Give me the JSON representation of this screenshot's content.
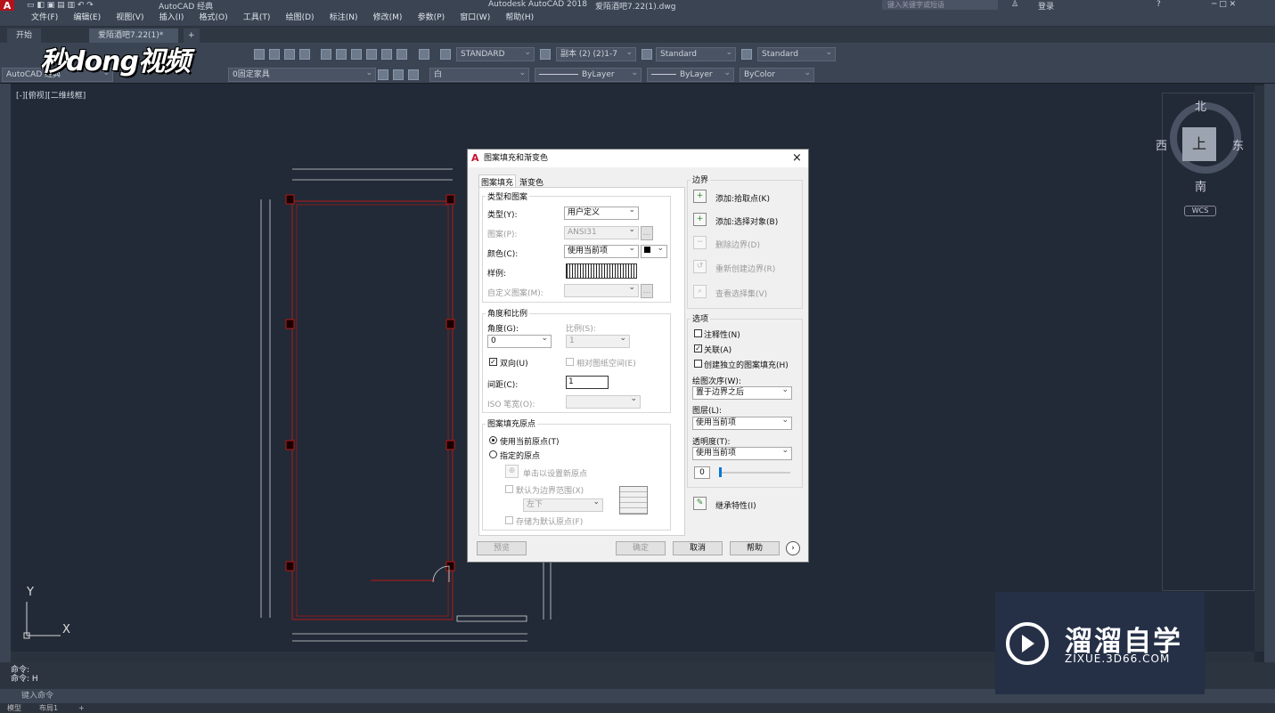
{
  "app": {
    "title": "Autodesk AutoCAD 2018",
    "file": "爱陌酒吧7.22(1).dwg",
    "search_placeholder": "键入关键字或短语",
    "login": "登录",
    "workspace": "AutoCAD 经典"
  },
  "menu": [
    "文件(F)",
    "编辑(E)",
    "视图(V)",
    "插入(I)",
    "格式(O)",
    "工具(T)",
    "绘图(D)",
    "标注(N)",
    "修改(M)",
    "参数(P)",
    "窗口(W)",
    "帮助(H)"
  ],
  "filetabs": {
    "start": "开始",
    "current": "爱陌酒吧7.22(1)*",
    "add": "+"
  },
  "toolbar": {
    "textstyle": "STANDARD",
    "dimstyle": "副本 (2) (2)1-7",
    "tablestyle": "Standard",
    "mleaderstyle": "Standard",
    "workspace_label": "AutoCAD 经典",
    "layer": "0固定家具",
    "color": "白",
    "linetype": "ByLayer",
    "lineweight": "ByLayer",
    "plotstyle": "ByColor"
  },
  "viewport": {
    "label": "[-][俯视][二维线框]"
  },
  "viewcube": {
    "north": "北",
    "south": "南",
    "east": "东",
    "west": "西",
    "top": "上",
    "wcs": "WCS"
  },
  "ucs": {
    "y": "Y",
    "x": "X"
  },
  "logo": "秒dong视频",
  "watermark": {
    "brand": "溜溜自学",
    "url": "ZIXUE.3D66.COM"
  },
  "command": {
    "line1": "命令:",
    "line2": "命令: H",
    "input_placeholder": "键入命令"
  },
  "statusbar": {
    "model": "模型",
    "layout": "布局1",
    "add": "+"
  },
  "dialog": {
    "title": "图案填充和渐变色",
    "close": "×",
    "tabs": [
      "图案填充",
      "渐变色"
    ],
    "type_pattern": {
      "title": "类型和图案",
      "type_label": "类型(Y):",
      "type_value": "用户定义",
      "pattern_label": "图案(P):",
      "pattern_value": "ANSI31",
      "color_label": "颜色(C):",
      "color_value": "使用当前项",
      "sample_label": "样例:",
      "custom_label": "自定义图案(M):"
    },
    "angle_scale": {
      "title": "角度和比例",
      "angle_label": "角度(G):",
      "angle_value": "0",
      "scale_label": "比例(S):",
      "scale_value": "1",
      "double_label": "双向(U)",
      "relative_label": "相对图纸空间(E)",
      "spacing_label": "间距(C):",
      "spacing_value": "1",
      "iso_label": "ISO 笔宽(O):"
    },
    "origin": {
      "title": "图案填充原点",
      "use_current": "使用当前原点(T)",
      "specified": "指定的原点",
      "click_set": "单击以设置新原点",
      "default_boundary": "默认为边界范围(X)",
      "position": "左下",
      "store_default": "存储为默认原点(F)"
    },
    "boundary": {
      "title": "边界",
      "add_pick": "添加:拾取点(K)",
      "add_select": "添加:选择对象(B)",
      "remove": "删除边界(D)",
      "recreate": "重新创建边界(R)",
      "view_sel": "查看选择集(V)"
    },
    "options": {
      "title": "选项",
      "annotative": "注释性(N)",
      "associative": "关联(A)",
      "separate": "创建独立的图案填充(H)",
      "draw_order_label": "绘图次序(W):",
      "draw_order": "置于边界之后",
      "layer_label": "图层(L):",
      "layer": "使用当前项",
      "transparency_label": "透明度(T):",
      "transparency": "使用当前项",
      "transparency_value": "0"
    },
    "inherit": "继承特性(I)",
    "buttons": {
      "preview": "预览",
      "ok": "确定",
      "cancel": "取消",
      "help": "帮助"
    }
  }
}
